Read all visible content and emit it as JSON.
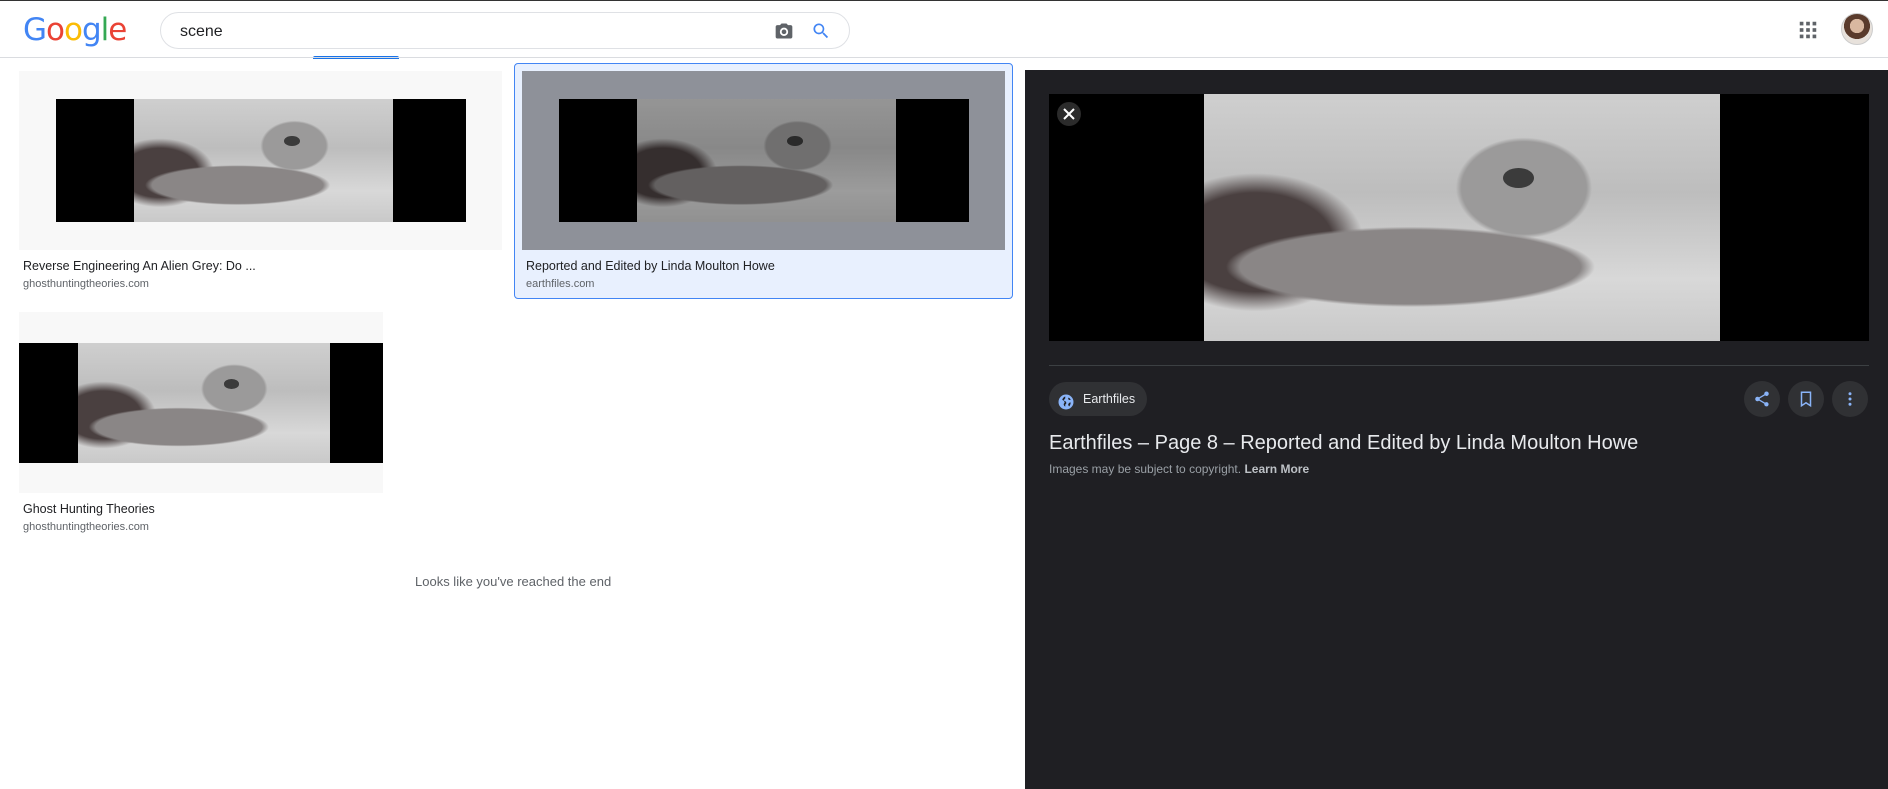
{
  "header": {
    "logo_letters": [
      "G",
      "o",
      "o",
      "g",
      "l",
      "e"
    ],
    "logo_colors": [
      "#4285F4",
      "#EA4335",
      "#FBBC05",
      "#4285F4",
      "#34A853",
      "#EA4335"
    ],
    "search_value": "scene",
    "accent": "#1a73e8"
  },
  "results": [
    {
      "caption": "Reverse Engineering An Alien Grey: Do ...",
      "domain": "ghosthuntingtheories.com"
    },
    {
      "caption": "Reported and Edited by Linda Moulton Howe",
      "domain": "earthfiles.com",
      "selected": true
    },
    {
      "caption": "Ghost Hunting Theories",
      "domain": "ghosthuntingtheories.com"
    }
  ],
  "end_message": "Looks like you've reached the end",
  "panel": {
    "source_name": "Earthfiles",
    "title": "Earthfiles – Page 8 – Reported and Edited by Linda Moulton Howe",
    "copyright_text": "Images may be subject to copyright.",
    "learn_more": "Learn More",
    "icons": [
      "close-icon",
      "globe-icon",
      "share-icon",
      "bookmark-icon",
      "more-vert-icon"
    ]
  }
}
